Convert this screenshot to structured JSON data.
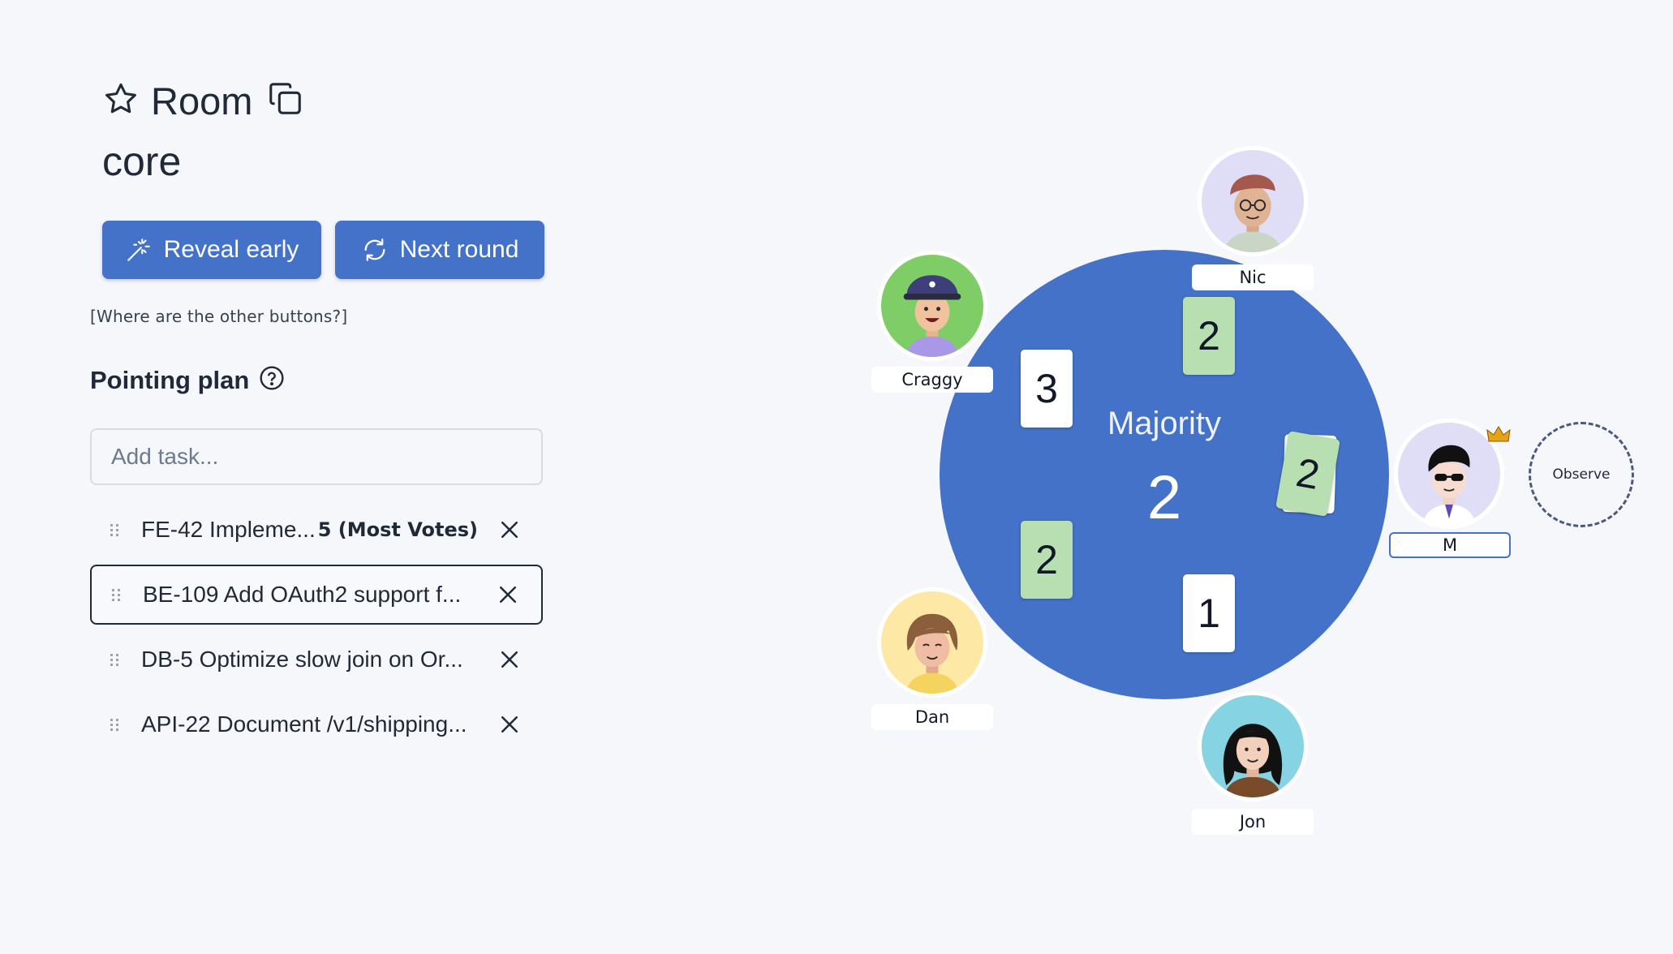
{
  "room": {
    "label": "Room",
    "name": "core"
  },
  "actions": {
    "reveal_label": "Reveal early",
    "next_label": "Next round",
    "hint": "[Where are the other buttons?]"
  },
  "plan": {
    "title": "Pointing plan",
    "input_placeholder": "Add task...",
    "tasks": [
      {
        "name": "FE-42 Impleme...",
        "votes": "5 (Most Votes)"
      },
      {
        "name": "BE-109 Add OAuth2 support f...",
        "votes": ""
      },
      {
        "name": "DB-5 Optimize slow join on Or...",
        "votes": ""
      },
      {
        "name": "API-22 Document /v1/shipping...",
        "votes": ""
      }
    ]
  },
  "table": {
    "result_label": "Majority",
    "result_value": "2",
    "cards": [
      {
        "owner": "Nic",
        "value": "2",
        "color": "#b7dfb1"
      },
      {
        "owner": "Craggy",
        "value": "3",
        "color": "#ffffff"
      },
      {
        "owner": "M",
        "value": "2",
        "color": "#b7dfb1"
      },
      {
        "owner": "Dan",
        "value": "2",
        "color": "#b7dfb1"
      },
      {
        "owner": "Jon",
        "value": "1",
        "color": "#ffffff"
      }
    ],
    "players": [
      {
        "name": "Nic",
        "avatar_bg": "#e0def7"
      },
      {
        "name": "Craggy",
        "avatar_bg": "#7fcd66"
      },
      {
        "name": "M",
        "avatar_bg": "#e0def7",
        "host": true
      },
      {
        "name": "Dan",
        "avatar_bg": "#fde8a6"
      },
      {
        "name": "Jon",
        "avatar_bg": "#86d3e3"
      }
    ],
    "observe_label": "Observe"
  },
  "colors": {
    "accent": "#4472c8",
    "vote_green": "#b7dfb1",
    "background": "#f6f7fb"
  }
}
